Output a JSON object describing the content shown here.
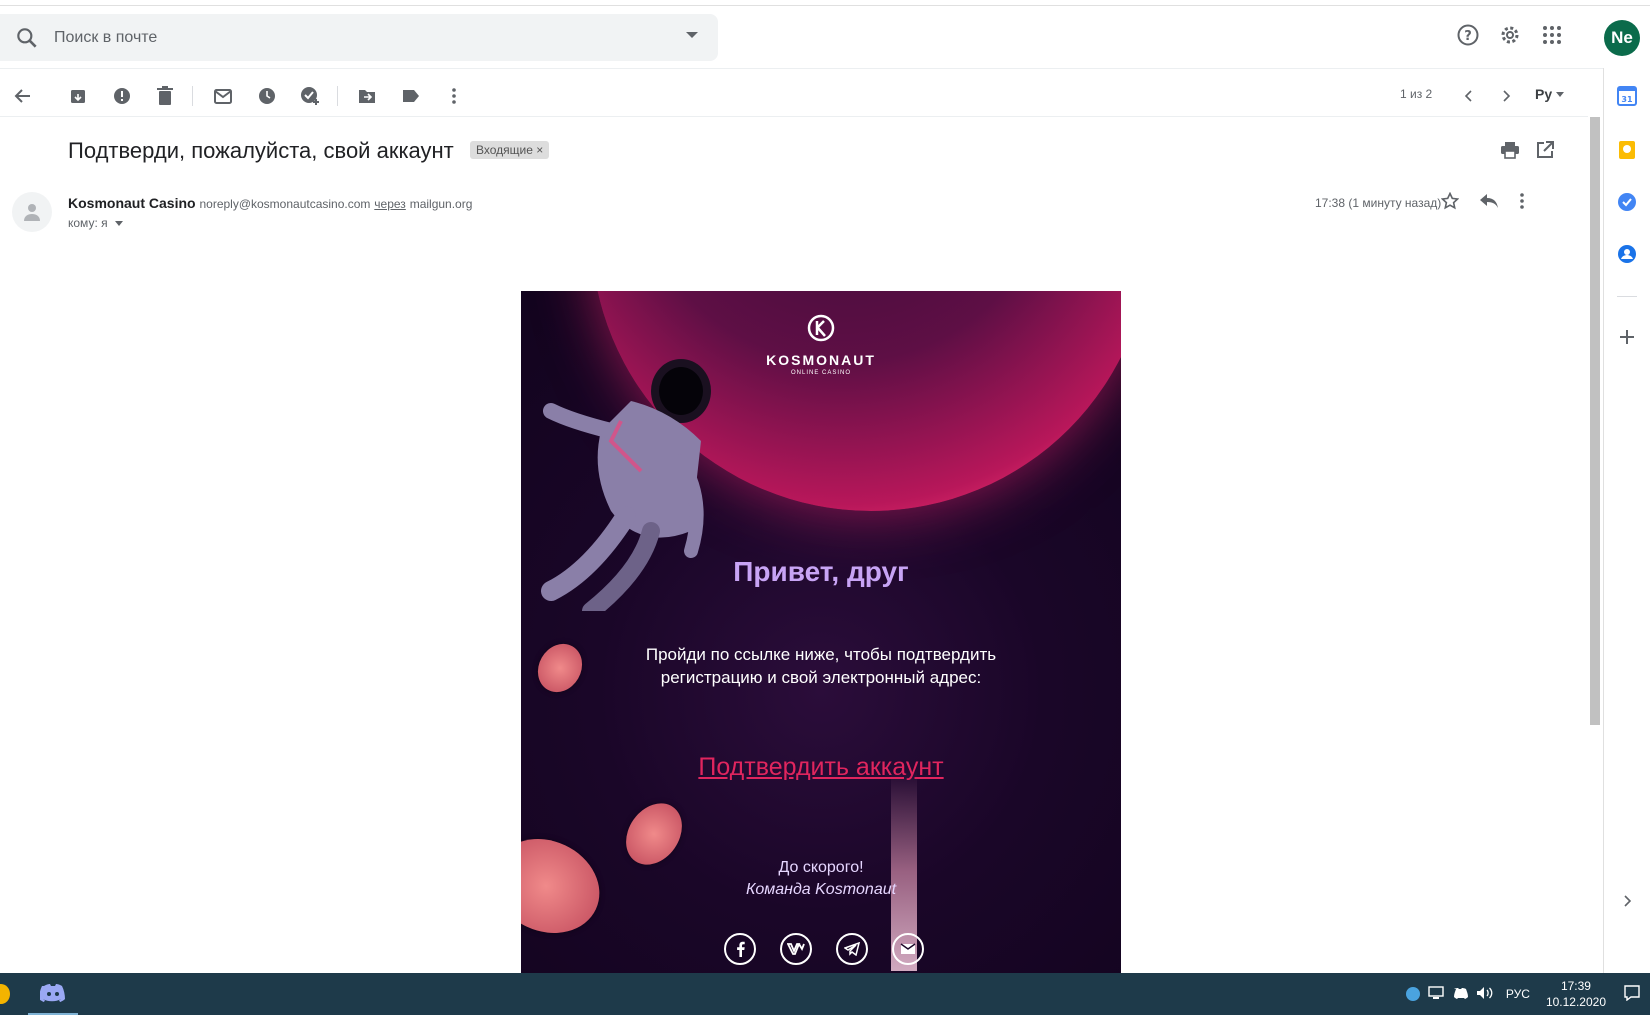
{
  "search": {
    "placeholder": "Поиск в почте"
  },
  "header": {
    "avatar": "Ne"
  },
  "toolbar": {
    "pager": "1 из 2",
    "lang": "Ру"
  },
  "message": {
    "subject": "Подтверди, пожалуйста, свой аккаунт",
    "label": "Входящие",
    "label_close": "×",
    "sender_name": "Kosmonaut Casino",
    "sender_email": "noreply@kosmonautcasino.com",
    "via": "через",
    "via_domain": "mailgun.org",
    "to": "кому: я",
    "time": "17:38 (1 минуту назад)"
  },
  "email": {
    "brand": "KOSMONAUT",
    "brand_sub": "ONLINE CASINO",
    "greeting": "Привет, друг",
    "body": "Пройди по ссылке ниже, чтобы подтвердить регистрацию и свой электронный адрес:",
    "cta": "Подтвердить аккаунт",
    "bye": "До скорого!",
    "team": "Команда Kosmonaut",
    "socials": [
      "f",
      "vk",
      "tg",
      "mail"
    ]
  },
  "taskbar": {
    "lang": "РУС",
    "time": "17:39",
    "date": "10.12.2020"
  },
  "colors": {
    "accent": "#e0255e",
    "greeting": "#c8a4f5",
    "avatar_bg": "#0b6b4b"
  }
}
